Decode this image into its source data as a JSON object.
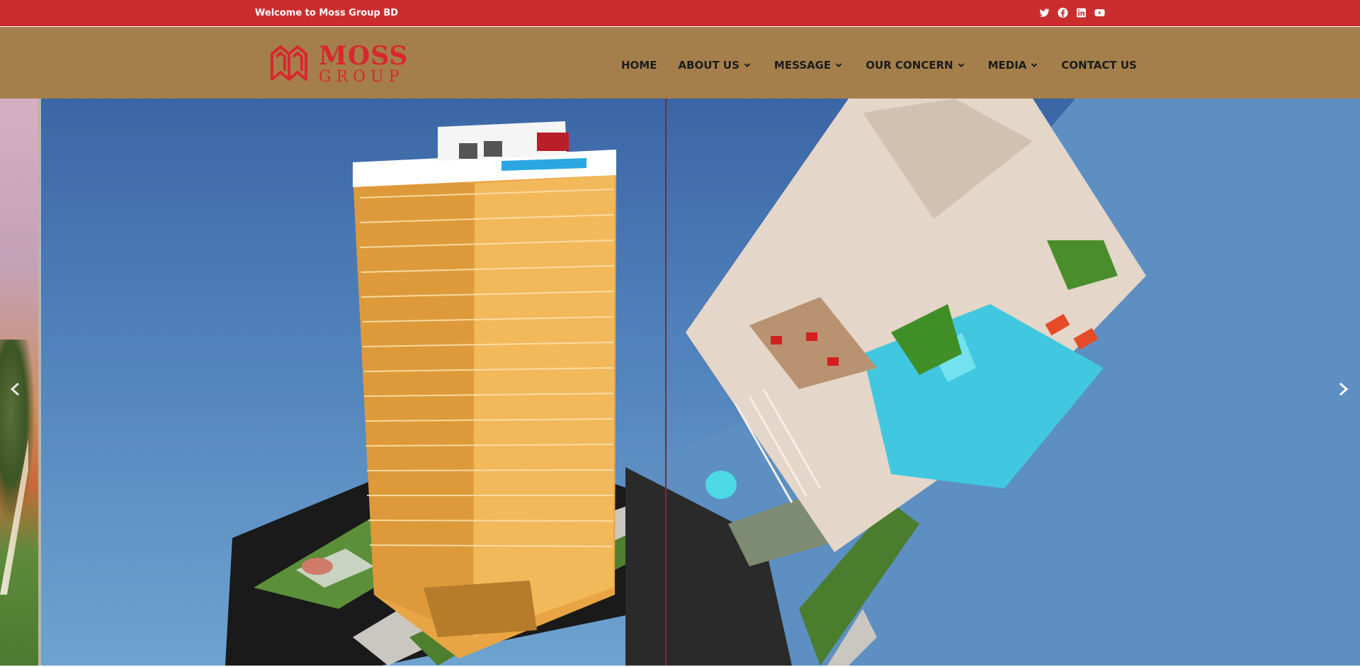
{
  "topbar": {
    "welcome": "Welcome to Moss Group BD",
    "background": "#cb2d2e",
    "social": [
      "twitter-icon",
      "facebook-icon",
      "linkedin-icon",
      "youtube-icon"
    ]
  },
  "header": {
    "background": "#a57f4b",
    "logo": {
      "line1": "MOSS",
      "line2": "GROUP",
      "color": "#d9272e"
    },
    "nav": [
      {
        "label": "HOME",
        "dropdown": false
      },
      {
        "label": "ABOUT US",
        "dropdown": true
      },
      {
        "label": "MESSAGE",
        "dropdown": true
      },
      {
        "label": "OUR CONCERN",
        "dropdown": true
      },
      {
        "label": "MEDIA",
        "dropdown": true
      },
      {
        "label": "CONTACT US",
        "dropdown": false
      }
    ]
  },
  "slider": {
    "prev_icon": "chevron-left-icon",
    "next_icon": "chevron-right-icon"
  }
}
